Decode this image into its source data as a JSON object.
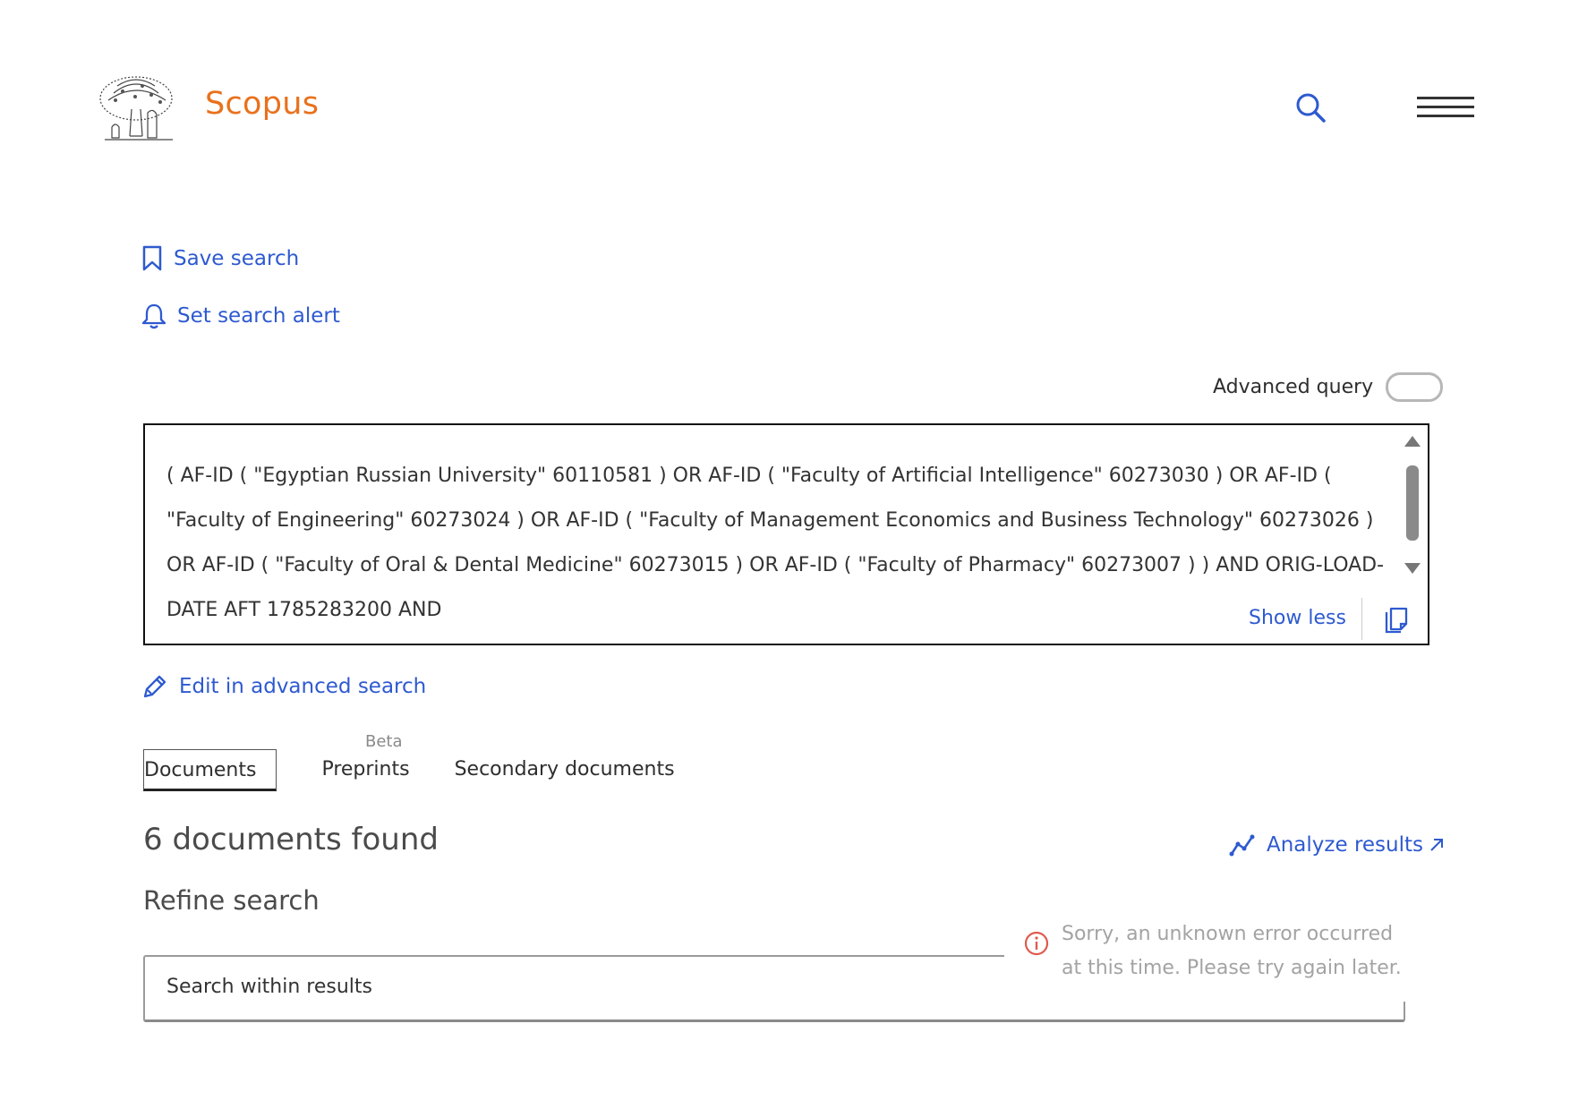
{
  "header": {
    "brand": "Scopus",
    "logo_icon": "elsevier-tree-logo",
    "search_icon": "search-icon",
    "menu_icon": "hamburger-menu-icon"
  },
  "actions": {
    "save_search": "Save search",
    "set_search_alert": "Set search alert",
    "edit_advanced": "Edit in advanced search"
  },
  "query": {
    "advanced_label": "Advanced query",
    "advanced_enabled": false,
    "text": "( AF-ID ( \"Egyptian Russian University\" 60110581 ) OR AF-ID ( \"Faculty of Artificial Intelligence\" 60273030 ) OR AF-ID ( \"Faculty of Engineering\" 60273024 ) OR AF-ID ( \"Faculty of Management Economics and Business Technology\" 60273026 ) OR AF-ID ( \"Faculty of Oral & Dental Medicine\" 60273015 ) OR AF-ID ( \"Faculty of Pharmacy\" 60273007 ) ) AND ORIG-LOAD-DATE AFT 1785283200 AND",
    "show_less": "Show less"
  },
  "tabs": [
    {
      "label": "Documents",
      "active": true
    },
    {
      "label": "Preprints",
      "active": false,
      "badge": "Beta"
    },
    {
      "label": "Secondary documents",
      "active": false
    }
  ],
  "results": {
    "count_text": "6 documents found",
    "analyze": "Analyze results",
    "refine_title": "Refine search",
    "search_within_placeholder": "Search within results"
  },
  "error": {
    "message": "Sorry, an unknown error occurred at this time. Please try again later."
  },
  "colors": {
    "brand": "#e9711c",
    "link": "#2e5ad0",
    "error": "#e05a4e"
  }
}
